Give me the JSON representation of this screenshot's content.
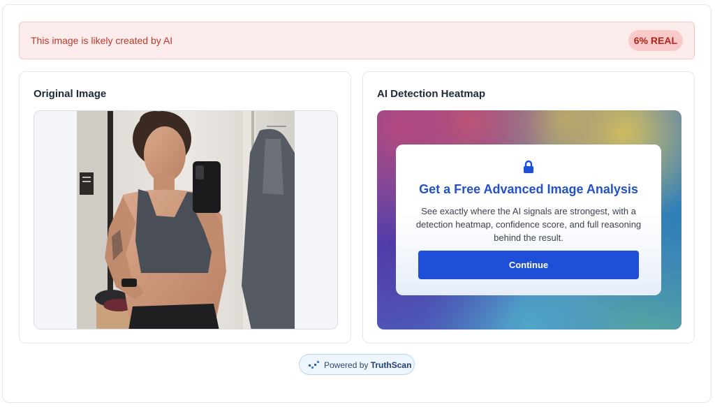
{
  "alert": {
    "message": "This image is likely created by AI",
    "badge": "6% REAL",
    "color": "#c0392b"
  },
  "original": {
    "title": "Original Image"
  },
  "heatmap": {
    "title": "AI Detection Heatmap",
    "upsell": {
      "icon": "lock-icon",
      "title": "Get a Free Advanced Image Analysis",
      "body": "See exactly where the AI signals are strongest, with a detection heatmap, confidence score, and full reasoning behind the result.",
      "button": "Continue"
    }
  },
  "footer": {
    "powered_prefix": "Powered by",
    "powered_brand": "TruthScan"
  },
  "colors": {
    "accent": "#1f4fd6",
    "alert_bg": "#fdecec",
    "title_blue": "#2352c6"
  }
}
